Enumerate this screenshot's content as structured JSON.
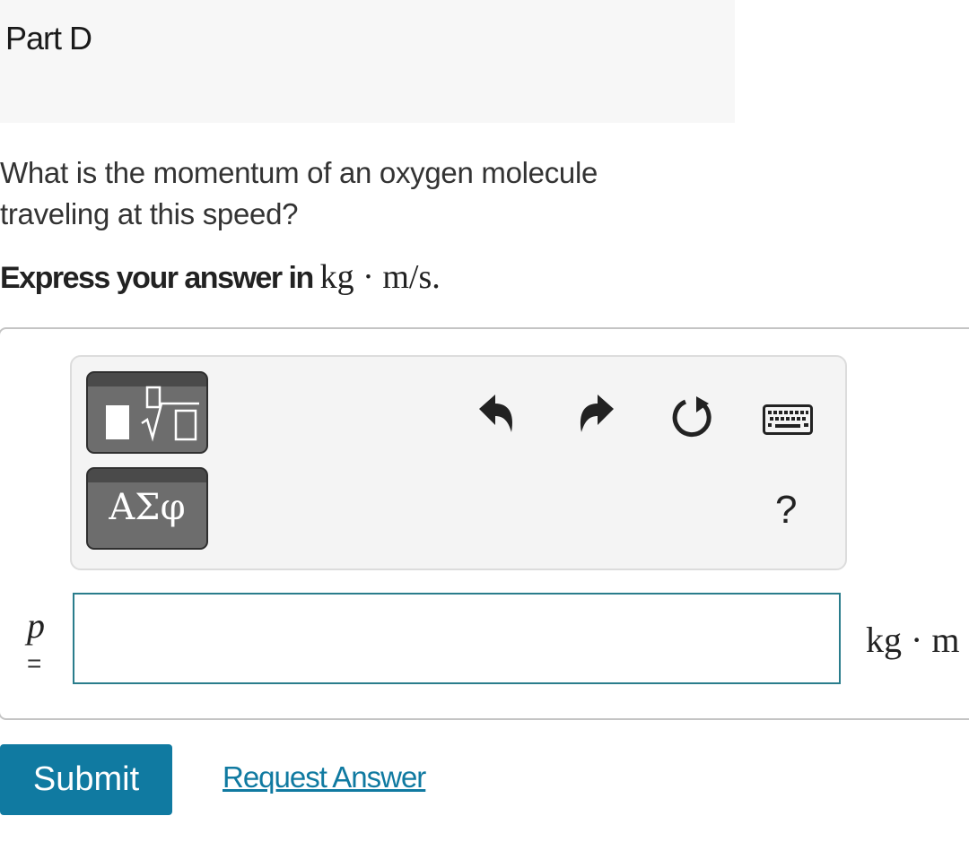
{
  "part": {
    "title": "Part D"
  },
  "question": {
    "text": "What is the momentum of an oxygen molecule traveling at this speed?",
    "instruction_prefix": "Express your answer in ",
    "instruction_units": "kg · m/s."
  },
  "toolbar": {
    "buttons": [
      {
        "name": "templates",
        "icon": "fraction-sqrt-template-icon"
      },
      {
        "name": "greek-symbols",
        "label": "ΑΣφ"
      },
      {
        "name": "undo",
        "icon": "undo-icon"
      },
      {
        "name": "redo",
        "icon": "redo-icon"
      },
      {
        "name": "reset",
        "icon": "reset-icon"
      },
      {
        "name": "keyboard",
        "icon": "keyboard-icon"
      },
      {
        "name": "help",
        "label": "?"
      }
    ]
  },
  "answer": {
    "variable": "p",
    "equals": "=",
    "value": "",
    "units": "kg · m"
  },
  "actions": {
    "submit_label": "Submit",
    "request_answer_label": "Request Answer"
  },
  "colors": {
    "accent": "#107aa1",
    "input_border": "#2a7d8c",
    "header_bg": "#f7f7f7"
  }
}
